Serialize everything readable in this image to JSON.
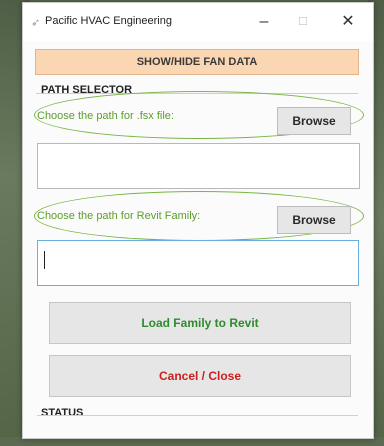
{
  "window": {
    "title": "Pacific HVAC Engineering",
    "icon": "app-icon",
    "controls": {
      "minimize": "–",
      "maximize": "☐",
      "close": "✕"
    }
  },
  "fan_toggle": {
    "label": "SHOW/HIDE FAN DATA"
  },
  "path_selector": {
    "title": "PATH SELECTOR",
    "fsx": {
      "hint": "Choose the path for .fsx file:",
      "browse_label": "Browse",
      "value": ""
    },
    "revit": {
      "hint": "Choose the path for Revit Family:",
      "browse_label": "Browse",
      "value": ""
    }
  },
  "actions": {
    "load_label": "Load Family to Revit",
    "cancel_label": "Cancel / Close"
  },
  "status": {
    "title": "STATUS"
  },
  "colors": {
    "toggle_bg": "#fbd6b3",
    "hint_green": "#5c9e2a",
    "load_green": "#2e8b2e",
    "cancel_red": "#cc1f1f",
    "focus_blue": "#6aaee0"
  }
}
